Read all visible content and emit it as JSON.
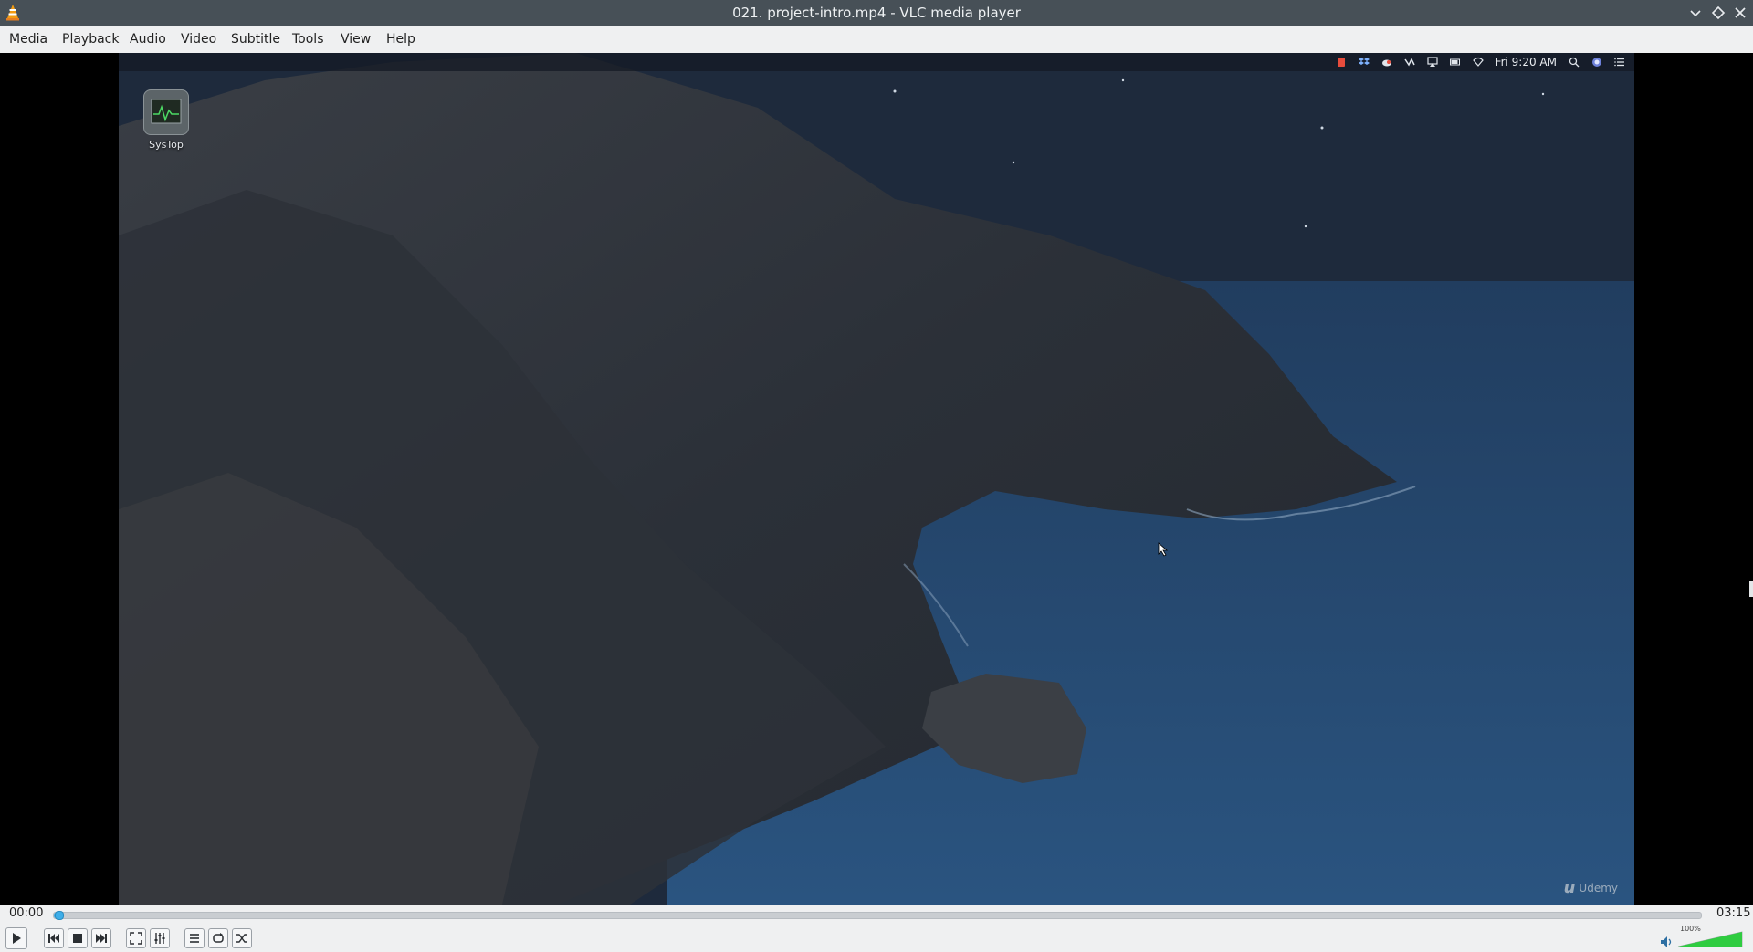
{
  "window": {
    "title": "021. project-intro.mp4 - VLC media player"
  },
  "menu": {
    "items": [
      "Media",
      "Playback",
      "Audio",
      "Video",
      "Subtitle",
      "Tools",
      "View",
      "Help"
    ]
  },
  "video": {
    "desktop_icon_label": "SysTop",
    "mac_clock": "Fri 9:20 AM",
    "watermark": "Udemy"
  },
  "controls": {
    "elapsed": "00:00",
    "total": "03:15",
    "progress_fraction": 0.003,
    "volume_label": "100%",
    "volume_fraction": 1.0
  },
  "colors": {
    "accent": "#3daee9",
    "titlebar": "#475057",
    "volume": "#2ecc40"
  }
}
